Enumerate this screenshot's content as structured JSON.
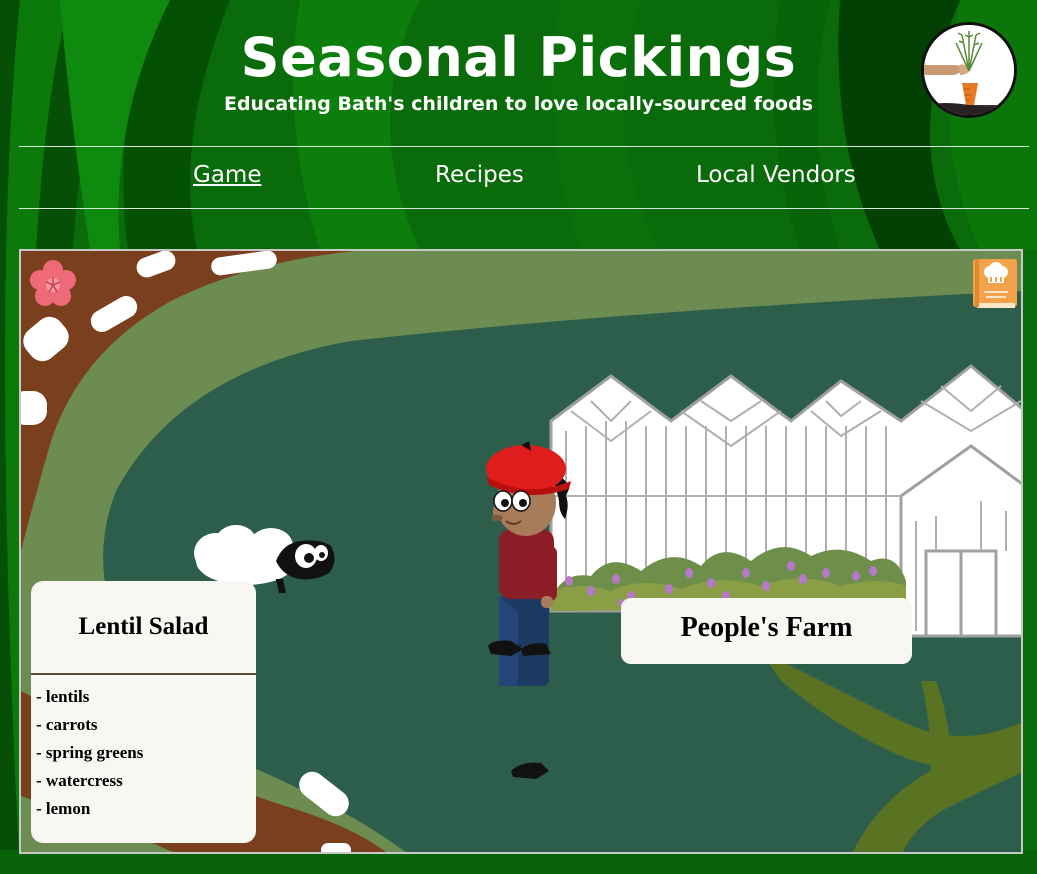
{
  "site": {
    "title": "Seasonal Pickings",
    "subtitle": "Educating Bath's children to love locally-sourced foods",
    "logo_icon": "carrot-pulled-by-hand-icon"
  },
  "nav": {
    "items": [
      {
        "label": "Game",
        "active": true
      },
      {
        "label": "Recipes",
        "active": false
      },
      {
        "label": "Local Vendors",
        "active": false
      }
    ]
  },
  "game": {
    "season_icon": "cherry-blossom-icon",
    "recipe_book_icon": "recipe-book-icon",
    "recipe_card": {
      "title": "Lentil Salad",
      "ingredients": [
        "- lentils",
        "- carrots",
        "- spring greens",
        "- watercress",
        "- lemon"
      ]
    },
    "location_label": "People's Farm"
  },
  "colors": {
    "page_bg": "#0a6b0a",
    "grass": "#2d5e4b",
    "path": "#6d8c52",
    "road": "#7a3f1d",
    "card": "#f8f7f2"
  }
}
